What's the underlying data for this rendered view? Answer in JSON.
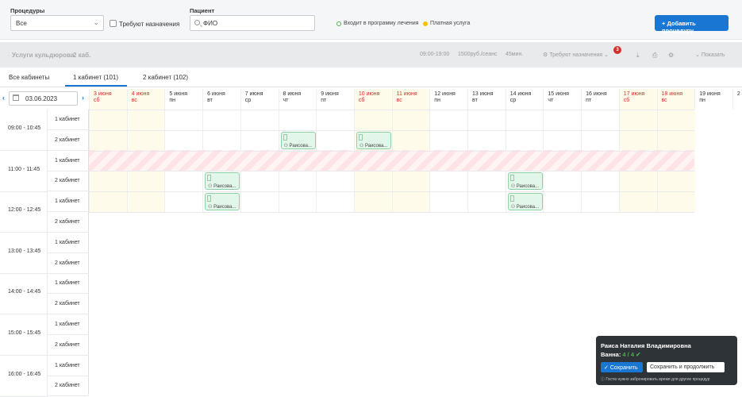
{
  "filters": {
    "procedures_label": "Процедуры",
    "procedures_value": "Все",
    "need_assign_label": "Требуют назначения",
    "patient_label": "Пациент",
    "patient_placeholder": "ФИО",
    "legend_program": "Входит в программу лечения",
    "legend_paid": "Платная услуга",
    "add_button": "Добавить процедуру",
    "colors": {
      "program": "#4caf50",
      "paid": "#ffc107",
      "accent": "#1976d2"
    }
  },
  "service_bar": {
    "title": "Услуги кульдюрова",
    "rooms": "2 каб.",
    "hours": "09:00-19:00",
    "price": "1500руб./сеанс",
    "duration": "45мин.",
    "need_assign": "Требуют назначения",
    "need_assign_count": "3",
    "show": "Показать"
  },
  "tabs": [
    "Все кабинеты",
    "1 кабинет (101)",
    "2 кабинет (102)"
  ],
  "date_nav": {
    "date": "03.06.2023"
  },
  "days": [
    {
      "d": "3 июня",
      "w": "сб",
      "we": true
    },
    {
      "d": "4 июня",
      "w": "вс",
      "we": true
    },
    {
      "d": "5 июня",
      "w": "пн",
      "we": false
    },
    {
      "d": "6 июня",
      "w": "вт",
      "we": false
    },
    {
      "d": "7 июня",
      "w": "ср",
      "we": false
    },
    {
      "d": "8 июня",
      "w": "чт",
      "we": false
    },
    {
      "d": "9 июня",
      "w": "пт",
      "we": false
    },
    {
      "d": "10 июня",
      "w": "сб",
      "we": true
    },
    {
      "d": "11 июня",
      "w": "вс",
      "we": true
    },
    {
      "d": "12 июня",
      "w": "пн",
      "we": false
    },
    {
      "d": "13 июня",
      "w": "вт",
      "we": false
    },
    {
      "d": "14 июня",
      "w": "ср",
      "we": false
    },
    {
      "d": "15 июня",
      "w": "чт",
      "we": false
    },
    {
      "d": "16 июня",
      "w": "пт",
      "we": false
    },
    {
      "d": "17 июня",
      "w": "сб",
      "we": true
    },
    {
      "d": "18 июня",
      "w": "вс",
      "we": true
    },
    {
      "d": "19 июня",
      "w": "пн",
      "we": false
    },
    {
      "d": "2",
      "w": "",
      "we": false
    }
  ],
  "slots": [
    "09:00 - 10:45",
    "11:00 - 11:45",
    "12:00 - 12:45",
    "13:00 - 13:45",
    "14:00 - 14:45",
    "15:00 - 15:45",
    "16:00 - 16:45"
  ],
  "room_labels": [
    "1 кабинет",
    "2 кабинет"
  ],
  "appointments": [
    {
      "day": 5,
      "row": 1,
      "label": "Раисова..."
    },
    {
      "day": 7,
      "row": 1,
      "label": "Раисова..."
    },
    {
      "day": 3,
      "row": 3,
      "label": "Раисова..."
    },
    {
      "day": 11,
      "row": 3,
      "label": "Раисова..."
    },
    {
      "day": 3,
      "row": 4,
      "label": "Раисова..."
    },
    {
      "day": 11,
      "row": 4,
      "label": "Раисова..."
    }
  ],
  "popup": {
    "name": "Раиса Наталия Владимировна",
    "bath_label": "Ванна:",
    "bath_value": "4 / 4",
    "save": "Сохранить",
    "save_continue": "Сохранить и продолжить",
    "note": "Гостю нужно забронировать время для других процедур"
  }
}
